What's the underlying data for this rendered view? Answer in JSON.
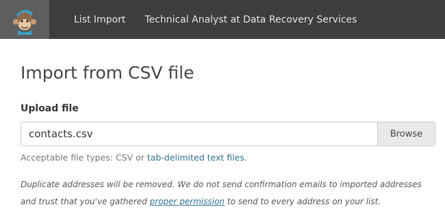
{
  "nav": {
    "logo_icon": "mailchimp-monkey-logo",
    "items": [
      {
        "label": "List Import"
      },
      {
        "label": "Technical Analyst at Data Recovery Services"
      }
    ]
  },
  "main": {
    "title": "Import from CSV file",
    "upload": {
      "label": "Upload file",
      "value": "contacts.csv",
      "browse_label": "Browse"
    },
    "help": {
      "prefix": "Acceptable file types: CSV or ",
      "link": "tab-delimited text files",
      "suffix": "."
    },
    "note": {
      "part1": "Duplicate addresses will be removed. We do not send confirmation emails to imported addresses and trust that you've gathered ",
      "link": "proper permission",
      "part2": " to send to every address on your list."
    }
  },
  "colors": {
    "topbar": "#3d3d3d",
    "logo_bg": "#5e5e5e",
    "link": "#2f6f8f"
  }
}
